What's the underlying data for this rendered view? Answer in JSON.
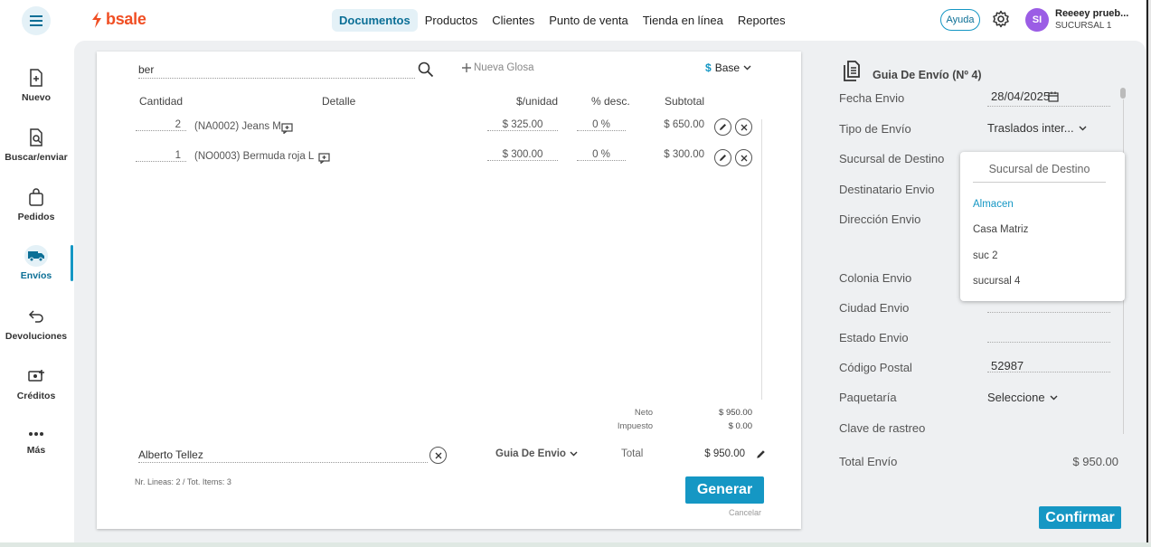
{
  "brand": {
    "name": "bsale",
    "logo_color": "#f04e23"
  },
  "topnav": {
    "items": [
      {
        "label": "Documentos",
        "active": true
      },
      {
        "label": "Productos",
        "active": false
      },
      {
        "label": "Clientes",
        "active": false
      },
      {
        "label": "Punto de venta",
        "active": false
      },
      {
        "label": "Tienda en línea",
        "active": false
      },
      {
        "label": "Reportes",
        "active": false
      }
    ],
    "help_label": "Ayuda",
    "user": {
      "initials": "SI",
      "name": "Reeeey prueb...",
      "branch": "SUCURSAL 1",
      "avatar_color": "#9b5de5"
    }
  },
  "sidebar": {
    "items": [
      {
        "label": "Nuevo",
        "icon": "new-document-icon"
      },
      {
        "label": "Buscar/enviar",
        "icon": "search-document-icon"
      },
      {
        "label": "Pedidos",
        "icon": "bag-icon"
      },
      {
        "label": "Envíos",
        "icon": "truck-icon",
        "active": true
      },
      {
        "label": "Devoluciones",
        "icon": "return-arrow-icon"
      },
      {
        "label": "Créditos",
        "icon": "credit-icon"
      },
      {
        "label": "Más",
        "icon": "more-dots-icon"
      }
    ],
    "accent_color": "#1597c4"
  },
  "document": {
    "search_value": "ber",
    "new_gloss_label": "Nueva Glosa",
    "currency_symbol": "$",
    "currency_label": "Base",
    "columns": {
      "qty": "Cantidad",
      "detail": "Detalle",
      "unit_price": "$/unidad",
      "discount": "% desc.",
      "subtotal": "Subtotal"
    },
    "rows": [
      {
        "qty": "2",
        "detail": "(NA0002) Jeans M",
        "unit_price": "$ 325.00",
        "discount": "0 %",
        "subtotal": "$ 650.00"
      },
      {
        "qty": "1",
        "detail": "(NO0003) Bermuda roja L",
        "unit_price": "$ 300.00",
        "discount": "0 %",
        "subtotal": "$ 300.00"
      }
    ],
    "totals": {
      "net_label": "Neto",
      "net_value": "$ 950.00",
      "tax_label": "Impuesto",
      "tax_value": "$ 0.00",
      "total_label": "Total",
      "total_value": "$ 950.00"
    },
    "client_name": "Alberto Tellez",
    "doc_type": "Guia De Envio",
    "lines_info": "Nr. Lineas: 2 / Tot. Items: 3",
    "generate_label": "Generar",
    "cancel_label": "Cancelar"
  },
  "shipping_panel": {
    "title": "Guia De Envío (Nº 4)",
    "fields": {
      "fecha_label": "Fecha Envio",
      "fecha_value": "28/04/2025",
      "tipo_label": "Tipo de Envío",
      "tipo_value": "Traslados inter...",
      "sucursal_label": "Sucursal de Destino",
      "destinatario_label": "Destinatario Envio",
      "direccion_label": "Dirección Envio",
      "colonia_label": "Colonia Envio",
      "ciudad_label": "Ciudad Envio",
      "estado_label": "Estado Envio",
      "cp_label": "Código Postal",
      "cp_value": "52987",
      "paqueteria_label": "Paquetaría",
      "paqueteria_value": "Seleccione",
      "clave_label": "Clave de rastreo",
      "total_label": "Total Envío",
      "total_value": "$ 950.00"
    },
    "confirm_label": "Confirmar"
  },
  "branch_dropdown": {
    "header": "Sucursal de Destino",
    "options": [
      {
        "label": "Almacen",
        "highlighted": true
      },
      {
        "label": "Casa Matriz",
        "highlighted": false
      },
      {
        "label": "suc 2",
        "highlighted": false
      },
      {
        "label": "sucursal 4",
        "highlighted": false
      }
    ]
  }
}
